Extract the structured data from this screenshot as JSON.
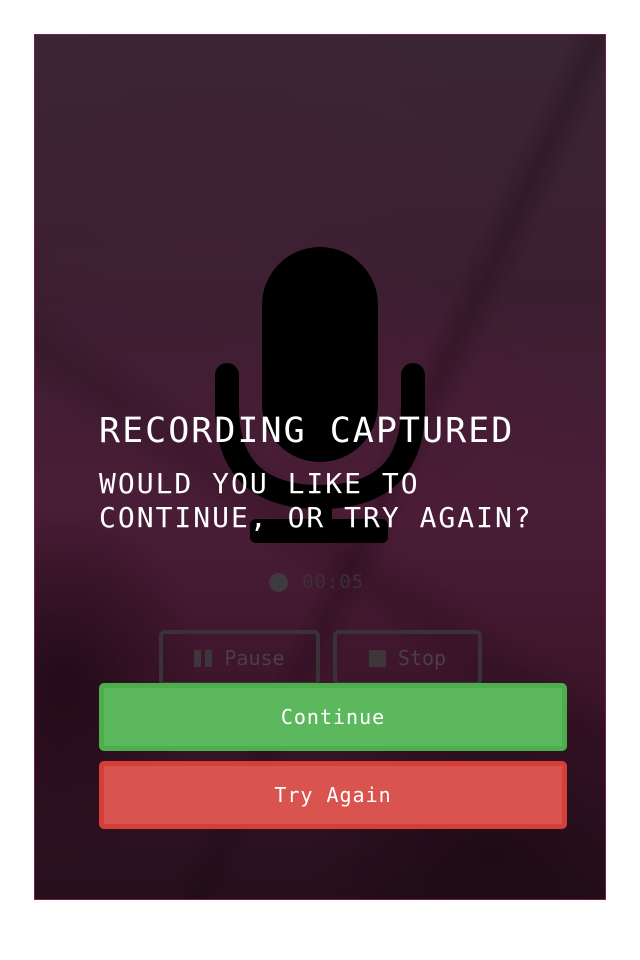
{
  "recorder": {
    "icon": "microphone-icon",
    "timer": "00:05",
    "pause_label": "Pause",
    "stop_label": "Stop"
  },
  "dialog": {
    "title": "RECORDING CAPTURED",
    "subtitle": "WOULD YOU LIKE TO CONTINUE, OR TRY AGAIN?",
    "continue_label": "Continue",
    "try_again_label": "Try Again"
  },
  "colors": {
    "continue": "#5cb85c",
    "try_again": "#d9534f",
    "frame_border": "#7a1d48"
  }
}
